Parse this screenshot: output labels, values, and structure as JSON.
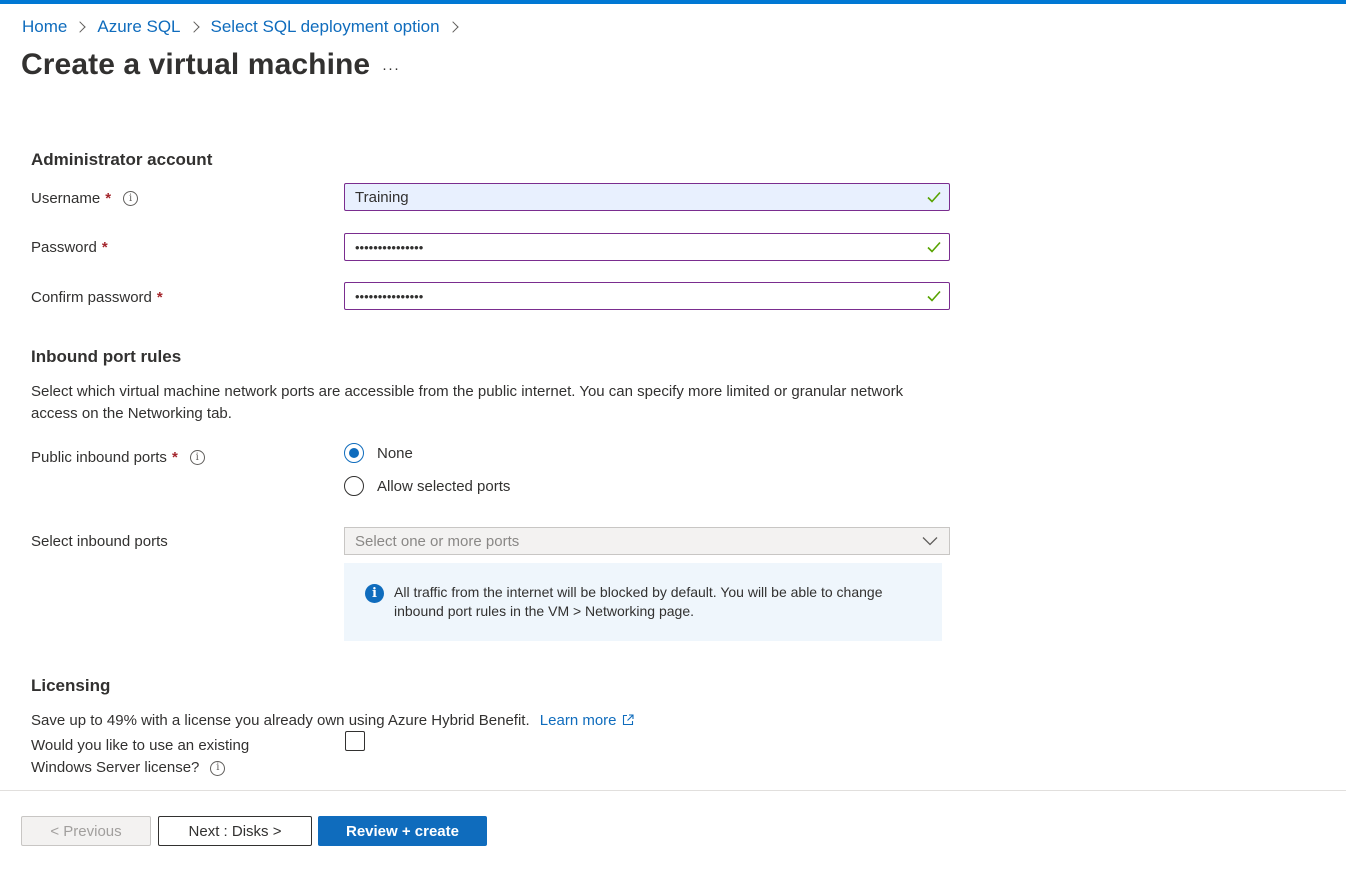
{
  "breadcrumb": [
    "Home",
    "Azure SQL",
    "Select SQL deployment option"
  ],
  "page": {
    "title": "Create a virtual machine",
    "more_glyph": "···"
  },
  "admin": {
    "title": "Administrator account",
    "username_label": "Username",
    "username_value": "Training",
    "password_label": "Password",
    "password_value": "•••••••••••••••",
    "confirm_label": "Confirm password",
    "confirm_value": "•••••••••••••••",
    "required_mark": "*"
  },
  "inbound": {
    "title": "Inbound port rules",
    "description": "Select which virtual machine network ports are accessible from the public internet. You can specify more limited or granular network access on the Networking tab.",
    "public_label": "Public inbound ports",
    "options": [
      "None",
      "Allow selected ports"
    ],
    "selected_option": "None",
    "select_label": "Select inbound ports",
    "select_placeholder": "Select one or more ports",
    "info_text": "All traffic from the internet will be blocked by default. You will be able to change inbound port rules in the VM > Networking page."
  },
  "licensing": {
    "title": "Licensing",
    "description": "Save up to 49% with a license you already own using Azure Hybrid Benefit.",
    "learn_more": "Learn more",
    "question_line1": "Would you like to use an existing",
    "question_line2": "Windows Server license?",
    "checked": false
  },
  "footer": {
    "previous": "< Previous",
    "next": "Next : Disks >",
    "review": "Review + create"
  },
  "colors": {
    "accent": "#0f6cbd",
    "field_border": "#7a2d8f",
    "valid_check": "#57a300",
    "required": "#a4262c"
  },
  "icons": {
    "valid": "checkmark-icon",
    "info": "info-icon",
    "dropdown": "chevron-down-icon",
    "external": "external-link-icon",
    "more": "more-icon"
  }
}
